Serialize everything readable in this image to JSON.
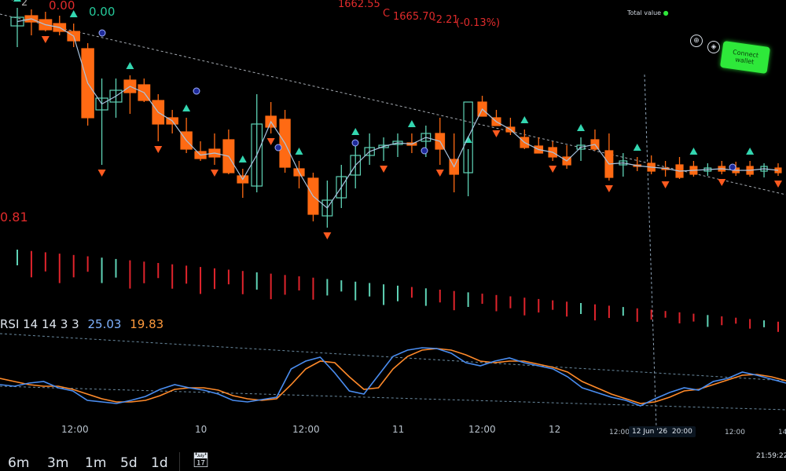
{
  "header": {
    "left_value_1": "0.00",
    "left_value_2": "0.00",
    "price_prefix": "1662.55",
    "close_label": "C",
    "close_value": "1665.70",
    "change": "-2.21",
    "change_pct": "(-0.13%)"
  },
  "wallet": {
    "total_value_label": "Total value",
    "connect_label": "Connect wallet"
  },
  "indicators": {
    "price_level": "0.81",
    "rsi_label": "RSI 14 14 3 3",
    "rsi_value_1": "25.03",
    "rsi_value_2": "19.83"
  },
  "x_axis": {
    "labels": [
      "12:00",
      "10",
      "12:00",
      "11",
      "12:00",
      "12",
      "12:00",
      "12:00",
      "14"
    ],
    "crosshair_date": "12 Jun '26",
    "crosshair_time": "20:00",
    "clock": "21:59:22"
  },
  "timeframes": [
    "6m",
    "3m",
    "1m",
    "5d",
    "1d"
  ],
  "colors": {
    "up": "#5fd3b6",
    "down": "#ff6a13",
    "rsi_k": "#4a8df0",
    "rsi_d": "#ff8a2a",
    "marker_up": "#33d6b0",
    "marker_down": "#ff5a1f",
    "accent_green": "#2ee83a",
    "text_red": "#e02b2b"
  },
  "chart_data": {
    "type": "candlestick",
    "candles": [
      {
        "o": 33,
        "h": 10,
        "l": 60,
        "c": 22
      },
      {
        "o": 20,
        "h": 12,
        "l": 45,
        "c": 28
      },
      {
        "o": 25,
        "h": 15,
        "l": 40,
        "c": 38
      },
      {
        "o": 30,
        "h": 20,
        "l": 45,
        "c": 40
      },
      {
        "o": 40,
        "h": 30,
        "l": 60,
        "c": 52
      },
      {
        "o": 62,
        "h": 55,
        "l": 160,
        "c": 150
      },
      {
        "o": 140,
        "h": 100,
        "l": 210,
        "c": 125
      },
      {
        "o": 130,
        "h": 100,
        "l": 150,
        "c": 115
      },
      {
        "o": 102,
        "h": 96,
        "l": 145,
        "c": 118
      },
      {
        "o": 108,
        "h": 100,
        "l": 130,
        "c": 128
      },
      {
        "o": 128,
        "h": 120,
        "l": 180,
        "c": 158
      },
      {
        "o": 150,
        "h": 140,
        "l": 170,
        "c": 158
      },
      {
        "o": 168,
        "h": 150,
        "l": 195,
        "c": 190
      },
      {
        "o": 193,
        "h": 180,
        "l": 205,
        "c": 202
      },
      {
        "o": 190,
        "h": 170,
        "l": 210,
        "c": 200
      },
      {
        "o": 178,
        "h": 165,
        "l": 222,
        "c": 220
      },
      {
        "o": 224,
        "h": 215,
        "l": 252,
        "c": 233
      },
      {
        "o": 237,
        "h": 120,
        "l": 245,
        "c": 158
      },
      {
        "o": 148,
        "h": 130,
        "l": 170,
        "c": 162
      },
      {
        "o": 152,
        "h": 140,
        "l": 220,
        "c": 213
      },
      {
        "o": 215,
        "h": 205,
        "l": 240,
        "c": 224
      },
      {
        "o": 227,
        "h": 220,
        "l": 282,
        "c": 273
      },
      {
        "o": 275,
        "h": 230,
        "l": 290,
        "c": 255
      },
      {
        "o": 252,
        "h": 210,
        "l": 265,
        "c": 225
      },
      {
        "o": 223,
        "h": 180,
        "l": 240,
        "c": 198
      },
      {
        "o": 198,
        "h": 170,
        "l": 210,
        "c": 188
      },
      {
        "o": 188,
        "h": 175,
        "l": 205,
        "c": 185
      },
      {
        "o": 184,
        "h": 170,
        "l": 200,
        "c": 180
      },
      {
        "o": 182,
        "h": 170,
        "l": 195,
        "c": 185
      },
      {
        "o": 180,
        "h": 160,
        "l": 200,
        "c": 170
      },
      {
        "o": 170,
        "h": 150,
        "l": 210,
        "c": 190
      },
      {
        "o": 203,
        "h": 170,
        "l": 245,
        "c": 222
      },
      {
        "o": 220,
        "h": 190,
        "l": 250,
        "c": 130
      },
      {
        "o": 130,
        "h": 122,
        "l": 148,
        "c": 148
      },
      {
        "o": 150,
        "h": 140,
        "l": 160,
        "c": 160
      },
      {
        "o": 162,
        "h": 150,
        "l": 172,
        "c": 168
      },
      {
        "o": 175,
        "h": 165,
        "l": 190,
        "c": 188
      },
      {
        "o": 186,
        "h": 175,
        "l": 195,
        "c": 195
      },
      {
        "o": 188,
        "h": 180,
        "l": 205,
        "c": 200
      },
      {
        "o": 200,
        "h": 185,
        "l": 215,
        "c": 210
      },
      {
        "o": 190,
        "h": 175,
        "l": 205,
        "c": 185
      },
      {
        "o": 178,
        "h": 165,
        "l": 192,
        "c": 190
      },
      {
        "o": 192,
        "h": 170,
        "l": 230,
        "c": 226
      },
      {
        "o": 210,
        "h": 195,
        "l": 225,
        "c": 205
      },
      {
        "o": 210,
        "h": 200,
        "l": 218,
        "c": 212
      },
      {
        "o": 208,
        "h": 198,
        "l": 222,
        "c": 218
      },
      {
        "o": 214,
        "h": 205,
        "l": 225,
        "c": 215
      },
      {
        "o": 210,
        "h": 200,
        "l": 228,
        "c": 226
      },
      {
        "o": 212,
        "h": 205,
        "l": 225,
        "c": 222
      },
      {
        "o": 218,
        "h": 208,
        "l": 224,
        "c": 214
      },
      {
        "o": 212,
        "h": 205,
        "l": 222,
        "c": 218
      },
      {
        "o": 214,
        "h": 206,
        "l": 224,
        "c": 220
      },
      {
        "o": 212,
        "h": 205,
        "l": 225,
        "c": 222
      },
      {
        "o": 218,
        "h": 208,
        "l": 226,
        "c": 212
      },
      {
        "o": 214,
        "h": 208,
        "l": 224,
        "c": 220
      }
    ],
    "rsi_k": [
      490,
      492,
      488,
      486,
      494,
      498,
      510,
      512,
      514,
      510,
      505,
      496,
      490,
      494,
      497,
      502,
      510,
      512,
      509,
      506,
      470,
      460,
      455,
      475,
      498,
      502,
      478,
      454,
      446,
      443,
      444,
      450,
      462,
      466,
      460,
      456,
      462,
      466,
      470,
      480,
      494,
      500,
      506,
      510,
      517,
      508,
      500,
      494,
      497,
      486,
      482,
      474,
      478,
      483,
      488
    ],
    "rsi_d": [
      482,
      486,
      490,
      492,
      492,
      496,
      502,
      508,
      512,
      512,
      510,
      504,
      496,
      494,
      494,
      497,
      504,
      508,
      510,
      508,
      490,
      470,
      460,
      462,
      480,
      496,
      494,
      470,
      454,
      446,
      444,
      446,
      452,
      460,
      462,
      460,
      460,
      464,
      468,
      474,
      486,
      494,
      502,
      508,
      514,
      512,
      506,
      498,
      496,
      490,
      484,
      478,
      477,
      480,
      485
    ]
  }
}
